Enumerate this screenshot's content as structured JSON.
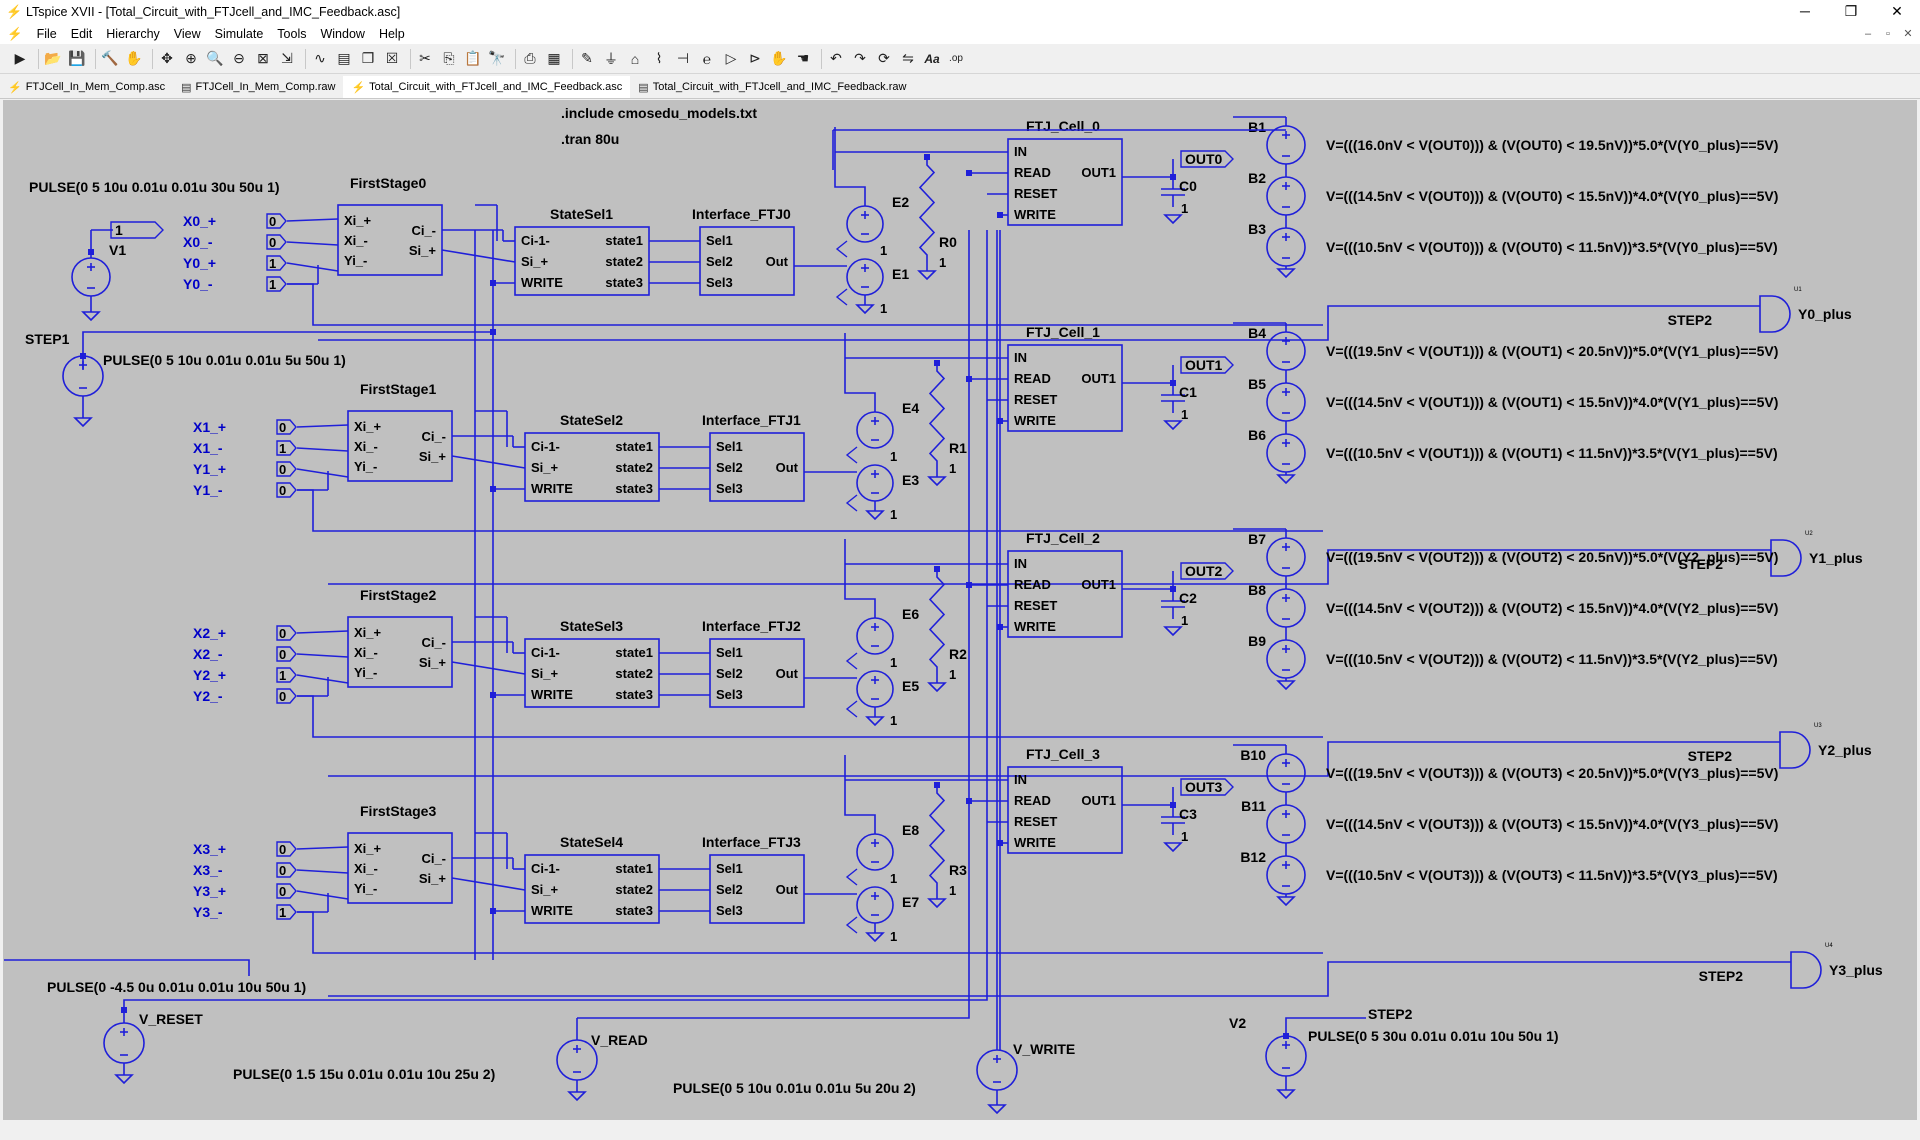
{
  "window": {
    "title": "LTspice XVII - [Total_Circuit_with_FTJcell_and_IMC_Feedback.asc]",
    "minimize": "─",
    "restore": "❐",
    "close": "✕"
  },
  "menu": [
    "File",
    "Edit",
    "Hierarchy",
    "View",
    "Simulate",
    "Tools",
    "Window",
    "Help"
  ],
  "toolbar_icons": [
    "run-icon",
    "open-icon",
    "save-icon",
    "control-panel-icon",
    "halt-icon",
    "pan-icon",
    "zoom-in-icon",
    "zoom-area-icon",
    "zoom-out-icon",
    "zoom-fit-icon",
    "autorange-icon",
    "waveform-icon",
    "tile-icon",
    "cascade-icon",
    "close-window-icon",
    "cut-icon",
    "copy-icon",
    "paste-icon",
    "find-icon",
    "print-icon",
    "print-preview-icon",
    "draw-wire-icon",
    "ground-icon",
    "label-net-icon",
    "resistor-icon",
    "capacitor-icon",
    "inductor-icon",
    "diode-icon",
    "component-icon",
    "move-icon",
    "drag-icon",
    "undo-icon",
    "redo-icon",
    "rotate-icon",
    "mirror-icon",
    "text-icon",
    "spice-directive-icon"
  ],
  "tabs": [
    {
      "label": "FTJCell_In_Mem_Comp.asc",
      "icon": "schematic-icon"
    },
    {
      "label": "FTJCell_In_Mem_Comp.raw",
      "icon": "waveform-icon"
    },
    {
      "label": "Total_Circuit_with_FTJcell_and_IMC_Feedback.asc",
      "icon": "schematic-icon",
      "active": true
    },
    {
      "label": "Total_Circuit_with_FTJcell_and_IMC_Feedback.raw",
      "icon": "waveform-icon"
    }
  ],
  "colors": {
    "canvas": "#c0c0c0",
    "wire": "#1f1fd9",
    "text": "#000000",
    "label_blue": "#0000c8"
  },
  "directives": [
    ".include cmosedu_models.txt",
    ".tran 80u"
  ],
  "sources": {
    "v1_pulse": "PULSE(0 5 10u 0.01u 0.01u 30u 50u 1)",
    "v1_name": "V1",
    "v1_node": "1",
    "step1_label": "STEP1",
    "step1_pulse": "PULSE(0 5 10u 0.01u 0.01u 5u 50u 1)",
    "vreset_pulse": "PULSE(0 -4.5 0u 0.01u 0.01u 10u 50u 1)",
    "vreset_name": "V_RESET",
    "vread_pulse": "PULSE(0 1.5 15u 0.01u 0.01u 10u 25u 2)",
    "vread_name": "V_READ",
    "vwrite_pulse": "PULSE(0 5 10u 0.01u 0.01u 5u 20u 2)",
    "vwrite_name": "V_WRITE",
    "v2_name": "V2",
    "v2_node": "STEP2",
    "v2_pulse": "PULSE(0 5 30u 0.01u 0.01u 10u 50u 1)"
  },
  "pins": {
    "first_stage": [
      "Xi_+",
      "Xi_-",
      "Yi_-"
    ],
    "first_stage_out": [
      "Ci_-",
      "Si_+"
    ],
    "state_sel_in": [
      "Ci-1-",
      "Si_+",
      "WRITE"
    ],
    "state_sel_out": [
      "state1",
      "state2",
      "state3"
    ],
    "interface_in": [
      "Sel1",
      "Sel2",
      "Sel3"
    ],
    "interface_out": "Out",
    "ftj_in": [
      "IN",
      "READ",
      "RESET",
      "WRITE"
    ],
    "ftj_out": "OUT1",
    "one": "1",
    "gate_node": "STEP2"
  },
  "stages": [
    {
      "first_stage": "FirstStage0",
      "state_sel": "StateSel1",
      "interface": "Interface_FTJ0",
      "ftj": "FTJ_Cell_0",
      "inputs": [
        {
          "label": "X0_+",
          "value": "0"
        },
        {
          "label": "X0_-",
          "value": "0"
        },
        {
          "label": "Y0_+",
          "value": "1"
        },
        {
          "label": "Y0_-",
          "value": "1"
        }
      ],
      "e_top": "E2",
      "e_bot": "E1",
      "resistor": "R0",
      "res_val": "1",
      "out_label": "OUT0",
      "cap": "C0",
      "cap_val": "1",
      "b": [
        "B1",
        "B2",
        "B3"
      ],
      "eq": [
        "V=(((16.0nV < V(OUT0))) & (V(OUT0) < 19.5nV))*5.0*(V(Y0_plus)==5V)",
        "V=(((14.5nV < V(OUT0))) & (V(OUT0) < 15.5nV))*4.0*(V(Y0_plus)==5V)",
        "V=(((10.5nV < V(OUT0))) & (V(OUT0) < 11.5nV))*3.5*(V(Y0_plus)==5V)"
      ],
      "gate_out": "Y0_plus",
      "gate_tag": "U1"
    },
    {
      "first_stage": "FirstStage1",
      "state_sel": "StateSel2",
      "interface": "Interface_FTJ1",
      "ftj": "FTJ_Cell_1",
      "inputs": [
        {
          "label": "X1_+",
          "value": "0"
        },
        {
          "label": "X1_-",
          "value": "1"
        },
        {
          "label": "Y1_+",
          "value": "0"
        },
        {
          "label": "Y1_-",
          "value": "0"
        }
      ],
      "e_top": "E4",
      "e_bot": "E3",
      "resistor": "R1",
      "res_val": "1",
      "out_label": "OUT1",
      "cap": "C1",
      "cap_val": "1",
      "b": [
        "B4",
        "B5",
        "B6"
      ],
      "eq": [
        "V=(((19.5nV < V(OUT1))) & (V(OUT1) < 20.5nV))*5.0*(V(Y1_plus)==5V)",
        "V=(((14.5nV < V(OUT1))) & (V(OUT1) < 15.5nV))*4.0*(V(Y1_plus)==5V)",
        "V=(((10.5nV < V(OUT1))) & (V(OUT1) < 11.5nV))*3.5*(V(Y1_plus)==5V)"
      ],
      "gate_out": "Y1_plus",
      "gate_tag": "U2"
    },
    {
      "first_stage": "FirstStage2",
      "state_sel": "StateSel3",
      "interface": "Interface_FTJ2",
      "ftj": "FTJ_Cell_2",
      "inputs": [
        {
          "label": "X2_+",
          "value": "0"
        },
        {
          "label": "X2_-",
          "value": "0"
        },
        {
          "label": "Y2_+",
          "value": "1"
        },
        {
          "label": "Y2_-",
          "value": "0"
        }
      ],
      "e_top": "E6",
      "e_bot": "E5",
      "resistor": "R2",
      "res_val": "1",
      "out_label": "OUT2",
      "cap": "C2",
      "cap_val": "1",
      "b": [
        "B7",
        "B8",
        "B9"
      ],
      "eq": [
        "V=(((19.5nV < V(OUT2))) & (V(OUT2) < 20.5nV))*5.0*(V(Y2_plus)==5V)",
        "V=(((14.5nV < V(OUT2))) & (V(OUT2) < 15.5nV))*4.0*(V(Y2_plus)==5V)",
        "V=(((10.5nV < V(OUT2))) & (V(OUT2) < 11.5nV))*3.5*(V(Y2_plus)==5V)"
      ],
      "gate_out": "Y2_plus",
      "gate_tag": "U3"
    },
    {
      "first_stage": "FirstStage3",
      "state_sel": "StateSel4",
      "interface": "Interface_FTJ3",
      "ftj": "FTJ_Cell_3",
      "inputs": [
        {
          "label": "X3_+",
          "value": "0"
        },
        {
          "label": "X3_-",
          "value": "0"
        },
        {
          "label": "Y3_+",
          "value": "0"
        },
        {
          "label": "Y3_-",
          "value": "1"
        }
      ],
      "e_top": "E8",
      "e_bot": "E7",
      "resistor": "R3",
      "res_val": "1",
      "out_label": "OUT3",
      "cap": "C3",
      "cap_val": "1",
      "b": [
        "B10",
        "B11",
        "B12"
      ],
      "eq": [
        "V=(((19.5nV < V(OUT3))) & (V(OUT3) < 20.5nV))*5.0*(V(Y3_plus)==5V)",
        "V=(((14.5nV < V(OUT3))) & (V(OUT3) < 15.5nV))*4.0*(V(Y3_plus)==5V)",
        "V=(((10.5nV < V(OUT3))) & (V(OUT3) < 11.5nV))*3.5*(V(Y3_plus)==5V)"
      ],
      "gate_out": "Y3_plus",
      "gate_tag": "U4"
    }
  ]
}
